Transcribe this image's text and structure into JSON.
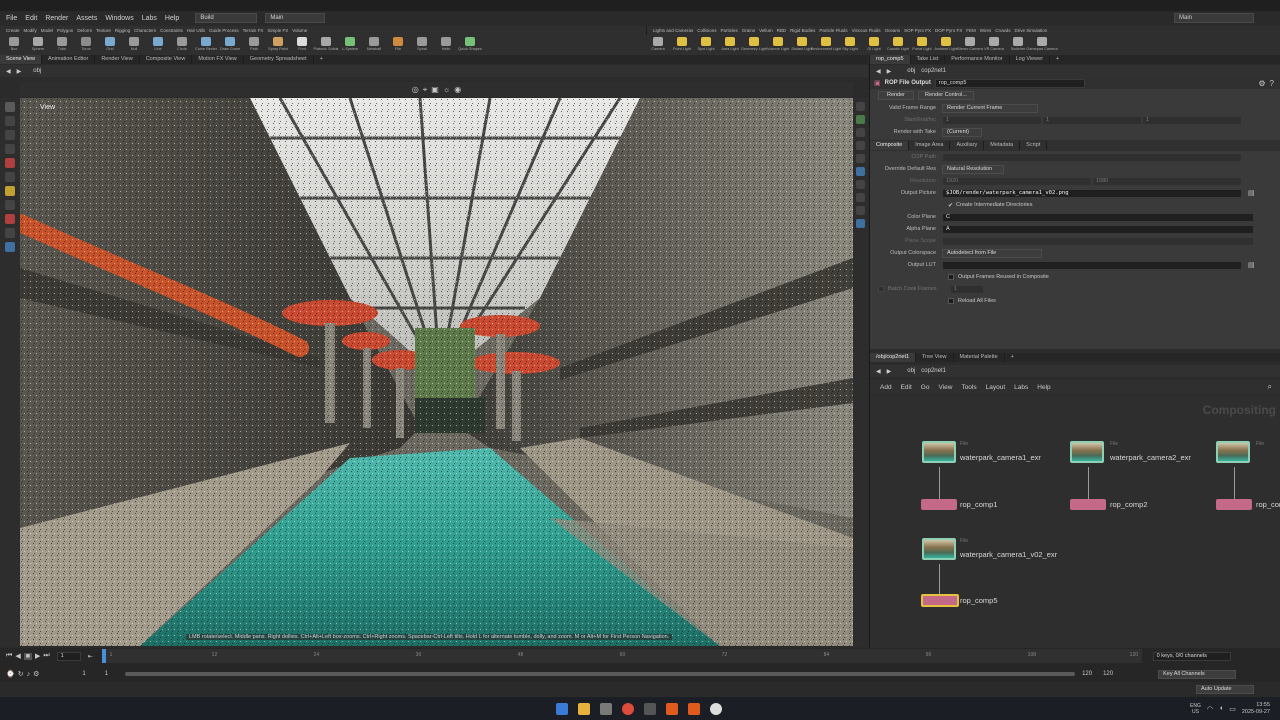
{
  "menubar": {
    "items": [
      "File",
      "Edit",
      "Render",
      "Assets",
      "Windows",
      "Labs",
      "Help"
    ],
    "desktop_dropdown": "Build",
    "layout_dropdown": "Main",
    "right_dropdown": "Main"
  },
  "shelf": {
    "left_tabs": [
      "Create",
      "Modify",
      "Model",
      "Polygon",
      "Deform",
      "Texture",
      "Rigging",
      "Characters",
      "Constraints",
      "Hair Utils",
      "Guide Process",
      "Terrain FX",
      "Simple FX",
      "Volume"
    ],
    "right_tabs": [
      "Lights and Cameras",
      "Collisions",
      "Particles",
      "Grains",
      "Vellum",
      "RBD",
      "Rigid Bodies",
      "Particle Fluids",
      "Viscous Fluids",
      "Oceans",
      "SOP Pyro FX",
      "DOP Pyro FX",
      "FEM",
      "Wires",
      "Crowds",
      "Drive Simulation"
    ],
    "left_tools": [
      "Box",
      "Sphere",
      "Tube",
      "Torus",
      "Grid",
      "Null",
      "Line",
      "Circle",
      "Curve Bezier",
      "Draw Curve",
      "Path",
      "Spray Paint",
      "Font",
      "Platonic Solids",
      "L-System",
      "Metaball",
      "File",
      "Spiral",
      "Helix",
      "Quick Shapes"
    ],
    "right_tools": [
      "Camera",
      "Point Light",
      "Spot Light",
      "Area Light",
      "Geometry Light",
      "Volume Light",
      "Distant Light",
      "Environment Light",
      "Sky Light",
      "GI Light",
      "Caustic Light",
      "Portal Light",
      "Ambient Light",
      "Stereo Camera",
      "VR Camera",
      "Switcher",
      "Gamepad Camera"
    ],
    "left_colors": [
      "#9a9a9a",
      "#a8a8a8",
      "#9a9a9a",
      "#8c8c8c",
      "#7aa9d0",
      "#9a9a9a",
      "#7aa9d0",
      "#9a9a9a",
      "#7aa9d0",
      "#7aa9d0",
      "#9a9a9a",
      "#d0a060",
      "#dddddd",
      "#a8a8a8",
      "#77c077",
      "#9a9a9a",
      "#d08a40",
      "#9a9a9a",
      "#9a9a9a",
      "#77c077"
    ],
    "right_colors": [
      "#aaaaaa",
      "#e0c040",
      "#e0c040",
      "#e0c040",
      "#e0c040",
      "#e0c040",
      "#e0c040",
      "#e0c040",
      "#e0c040",
      "#e0c040",
      "#e0c040",
      "#e0c040",
      "#e0c040",
      "#aaaaaa",
      "#aaaaaa",
      "#aaaaaa",
      "#aaaaaa"
    ]
  },
  "left_pane": {
    "tabs": [
      "Scene View",
      "Animation Editor",
      "Render View",
      "Composite View",
      "Motion FX View",
      "Geometry Spreadsheet"
    ],
    "path": "obj",
    "viewport_label": "View",
    "status_hint": "LMB rotate/select. Middle pans. Right dollies. Ctrl+Alt+Left box-zooms. Ctrl+Right zooms. Spacebar-Ctrl-Left tilts. Hold L for alternate tumble, dolly, and zoom. M or Alt+M for First Person Navigation."
  },
  "param_pane": {
    "tabs": [
      "rop_comp5",
      "Take List",
      "Performance Monitor",
      "Log Viewer"
    ],
    "path": [
      "obj",
      "cop2net1"
    ],
    "node_type": "ROP File Output",
    "node_name": "rop_comp5",
    "buttons": [
      "Render",
      "Render Control..."
    ],
    "valid_frame_range": {
      "label": "Valid Frame Range",
      "value": "Render Current Frame"
    },
    "start_end_inc": {
      "label": "Start/End/Inc",
      "values": [
        "1",
        "1",
        "1"
      ]
    },
    "render_with_take": {
      "label": "Render with Take",
      "value": "(Current)"
    },
    "subtabs": [
      "Composite",
      "Image Area",
      "Auxiliary",
      "Metadata",
      "Script"
    ],
    "cop_path": {
      "label": "COP Path",
      "value": ""
    },
    "override_res": {
      "label": "Override Default Res",
      "value": "Natural Resolution"
    },
    "resolution": {
      "label": "Resolution",
      "values": [
        "1920",
        "1080"
      ]
    },
    "output_picture": {
      "label": "Output Picture",
      "value": "$JOB/render/waterpark_camera1_v02.png"
    },
    "create_dirs": "Create Intermediate Directories",
    "color_plane": {
      "label": "Color Plane",
      "value": "C"
    },
    "alpha_plane": {
      "label": "Alpha Plane",
      "value": "A"
    },
    "plane_scope": {
      "label": "Plane Scope",
      "value": ""
    },
    "output_colorspace": {
      "label": "Output Colorspace",
      "value": "Autodetect from File"
    },
    "output_lut": {
      "label": "Output LUT",
      "value": ""
    },
    "output_frames_reused": "Output Frames Reused in Composite",
    "batch_cook_frames": {
      "label": "Batch Cook Frames",
      "value": "1"
    },
    "reload_all_files": "Reload All Files"
  },
  "network_pane": {
    "tabs": [
      "/obj/cop2net1",
      "Tree View",
      "Material Palette"
    ],
    "path": [
      "obj",
      "cop2net1"
    ],
    "menu": [
      "Add",
      "Edit",
      "Go",
      "View",
      "Tools",
      "Layout",
      "Labs",
      "Help"
    ],
    "context_label": "Compositing",
    "nodes": {
      "file1": {
        "type": "File",
        "name": "waterpark_camera1_exr"
      },
      "file2": {
        "type": "File",
        "name": "waterpark_camera2_exr"
      },
      "file3": {
        "type": "File",
        "name": ""
      },
      "file4": {
        "type": "File",
        "name": "waterpark_camera1_v02_exr"
      },
      "rop1": "rop_comp1",
      "rop2": "rop_comp2",
      "rop3": "rop_comp",
      "rop5": "rop_comp5"
    }
  },
  "timeline": {
    "frame": "1",
    "start": "1",
    "start2": "1",
    "end": "120",
    "end2": "120",
    "ticks": [
      "1",
      "12",
      "24",
      "36",
      "48",
      "60",
      "72",
      "84",
      "96",
      "108",
      "120"
    ],
    "keys": "0 keys, 0/0 channels",
    "key_all": "Key All Channels",
    "auto_update": "Auto Update"
  },
  "taskbar": {
    "lang": "ENG",
    "region": "US",
    "time": "13:55",
    "date": "2025-09-27"
  }
}
